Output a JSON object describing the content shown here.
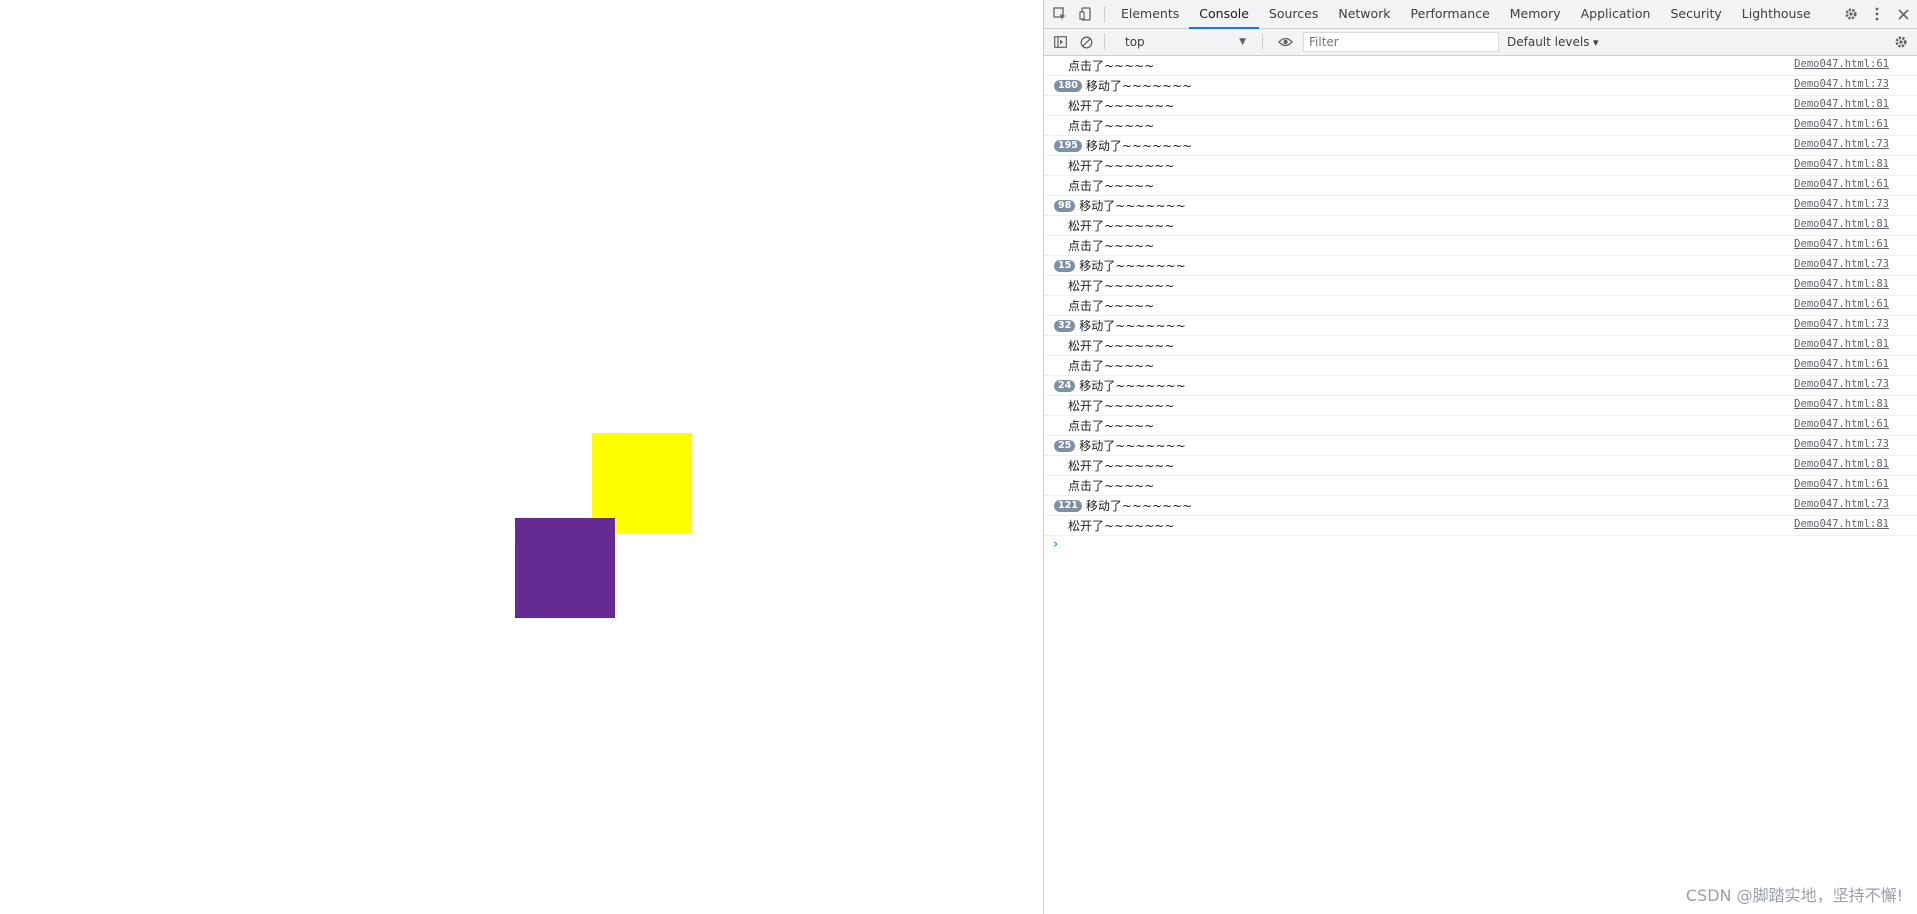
{
  "viewport": {
    "yellow_color": "#ffff00",
    "purple_color": "#662a93"
  },
  "devtools": {
    "left_icons": [
      "inspect-icon",
      "device-toggle-icon"
    ],
    "tabs": [
      {
        "label": "Elements"
      },
      {
        "label": "Console",
        "active": true
      },
      {
        "label": "Sources"
      },
      {
        "label": "Network"
      },
      {
        "label": "Performance"
      },
      {
        "label": "Memory"
      },
      {
        "label": "Application"
      },
      {
        "label": "Security"
      },
      {
        "label": "Lighthouse"
      }
    ],
    "right_icons": [
      "gear-icon",
      "more-icon",
      "close-icon"
    ]
  },
  "toolbar": {
    "context": "top",
    "filter_placeholder": "Filter",
    "levels_label": "Default levels"
  },
  "console": {
    "rows": [
      {
        "count": "",
        "text": "点击了~~~~~",
        "source": "Demo047.html:61"
      },
      {
        "count": "180",
        "text": "移动了~~~~~~~",
        "source": "Demo047.html:73"
      },
      {
        "count": "",
        "text": "松开了~~~~~~~",
        "source": "Demo047.html:81"
      },
      {
        "count": "",
        "text": "点击了~~~~~",
        "source": "Demo047.html:61"
      },
      {
        "count": "195",
        "text": "移动了~~~~~~~",
        "source": "Demo047.html:73"
      },
      {
        "count": "",
        "text": "松开了~~~~~~~",
        "source": "Demo047.html:81"
      },
      {
        "count": "",
        "text": "点击了~~~~~",
        "source": "Demo047.html:61"
      },
      {
        "count": "98",
        "text": "移动了~~~~~~~",
        "source": "Demo047.html:73"
      },
      {
        "count": "",
        "text": "松开了~~~~~~~",
        "source": "Demo047.html:81"
      },
      {
        "count": "",
        "text": "点击了~~~~~",
        "source": "Demo047.html:61"
      },
      {
        "count": "15",
        "text": "移动了~~~~~~~",
        "source": "Demo047.html:73"
      },
      {
        "count": "",
        "text": "松开了~~~~~~~",
        "source": "Demo047.html:81"
      },
      {
        "count": "",
        "text": "点击了~~~~~",
        "source": "Demo047.html:61"
      },
      {
        "count": "32",
        "text": "移动了~~~~~~~",
        "source": "Demo047.html:73"
      },
      {
        "count": "",
        "text": "松开了~~~~~~~",
        "source": "Demo047.html:81"
      },
      {
        "count": "",
        "text": "点击了~~~~~",
        "source": "Demo047.html:61"
      },
      {
        "count": "24",
        "text": "移动了~~~~~~~",
        "source": "Demo047.html:73"
      },
      {
        "count": "",
        "text": "松开了~~~~~~~",
        "source": "Demo047.html:81"
      },
      {
        "count": "",
        "text": "点击了~~~~~",
        "source": "Demo047.html:61"
      },
      {
        "count": "25",
        "text": "移动了~~~~~~~",
        "source": "Demo047.html:73"
      },
      {
        "count": "",
        "text": "松开了~~~~~~~",
        "source": "Demo047.html:81"
      },
      {
        "count": "",
        "text": "点击了~~~~~",
        "source": "Demo047.html:61"
      },
      {
        "count": "121",
        "text": "移动了~~~~~~~",
        "source": "Demo047.html:73"
      },
      {
        "count": "",
        "text": "松开了~~~~~~~",
        "source": "Demo047.html:81"
      }
    ],
    "prompt_glyph": "›"
  },
  "watermark": "CSDN @脚踏实地，坚持不懈!"
}
